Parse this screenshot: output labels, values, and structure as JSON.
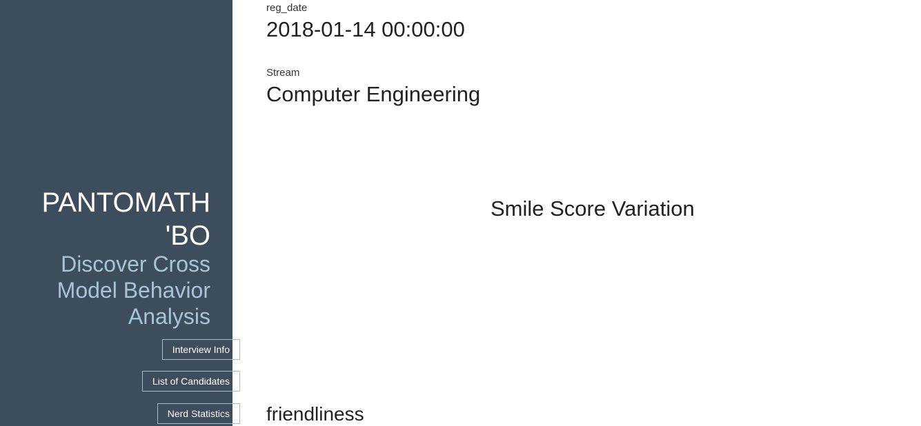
{
  "sidebar": {
    "title": "PANTOMATH 'BO",
    "subtitle": "Discover Cross Model Behavior Analysis",
    "nav": [
      {
        "label": "Interview Info"
      },
      {
        "label": "List of Candidates"
      },
      {
        "label": "Nerd Statistics"
      }
    ]
  },
  "main": {
    "reg_date": {
      "label": "reg_date",
      "value": "2018-01-14 00:00:00"
    },
    "stream": {
      "label": "Stream",
      "value": "Computer Engineering"
    },
    "chart_title": "Smile Score Variation",
    "section_heading": "friendliness"
  },
  "colors": {
    "sidebar_bg": "#3d4d5c",
    "subtitle": "#a9c4d9",
    "button_border": "#a9bccb"
  }
}
